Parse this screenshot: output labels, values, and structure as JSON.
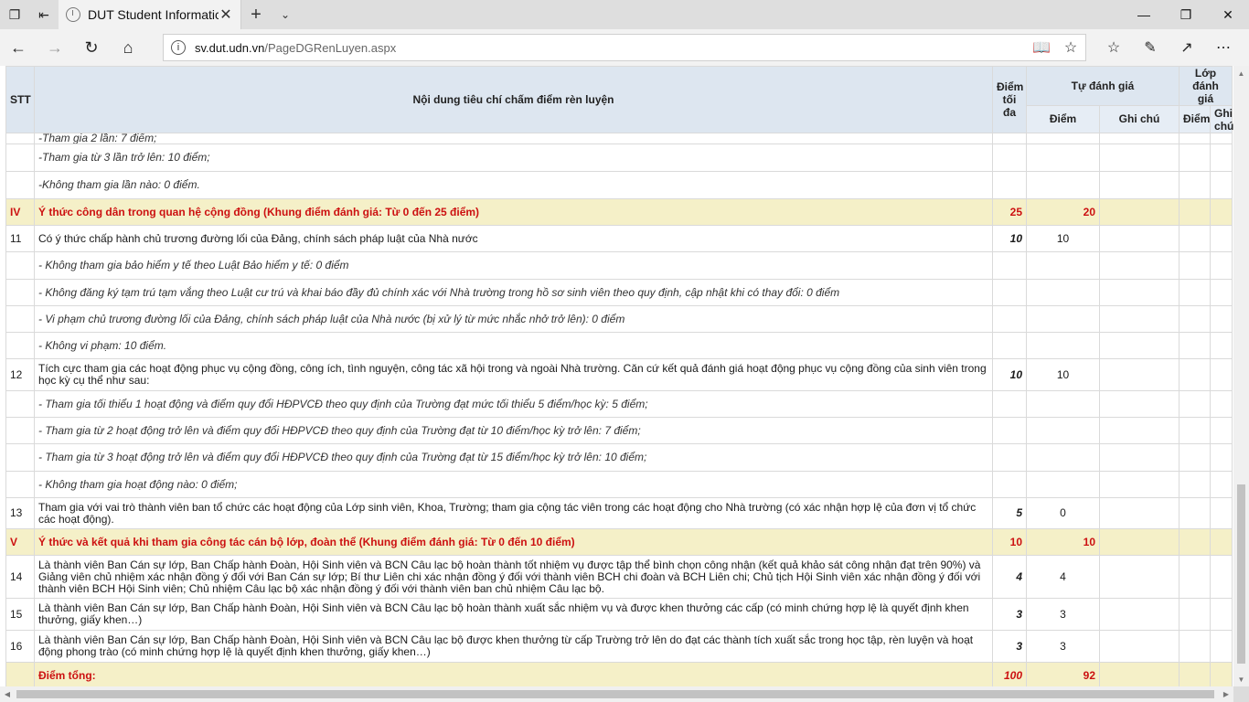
{
  "browser": {
    "tab_title": "DUT Student Informatic",
    "url_host": "sv.dut.udn.vn",
    "url_path": "/PageDGRenLuyen.aspx"
  },
  "table": {
    "headers": {
      "stt": "STT",
      "content": "Nội dung tiêu chí chấm điểm rèn luyện",
      "max_line1": "Điểm",
      "max_line2": "tối đa",
      "self": "Tự đánh giá",
      "self_score": "Điểm",
      "self_note": "Ghi chú",
      "class_line1": "Lớp",
      "class_line2": "đánh giá",
      "class_score": "Điểm",
      "class_note_line1": "Ghi",
      "class_note_line2": "chú"
    },
    "rows": [
      {
        "type": "cut",
        "text": "-Tham gia 2 lần: 7 điểm;"
      },
      {
        "type": "sub",
        "text": "-Tham gia từ 3 lần trở lên: 10 điểm;"
      },
      {
        "type": "sub",
        "text": "-Không tham gia lần nào: 0 điểm."
      },
      {
        "type": "sec",
        "stt": "IV",
        "text": "Ý thức công dân trong quan hệ cộng đồng (Khung điểm đánh giá: Từ 0 đến 25 điểm)",
        "max": "25",
        "score": "20"
      },
      {
        "type": "item",
        "stt": "11",
        "text": "Có ý thức chấp hành chủ trương đường lối của Đảng, chính sách pháp luật của Nhà nước",
        "max": "10",
        "score": "10"
      },
      {
        "type": "sub",
        "text": "- Không tham gia bảo hiểm y tế theo Luật Bảo hiểm y tế: 0 điểm"
      },
      {
        "type": "sub",
        "text": "- Không đăng ký tạm trú tạm vắng theo Luật cư trú và khai báo đầy đủ chính xác với Nhà trường trong hồ sơ sinh viên theo quy định, cập nhật khi có thay đổi: 0 điểm"
      },
      {
        "type": "sub",
        "text": "- Vi phạm chủ trương đường lối của Đảng, chính sách pháp luật của Nhà nước (bị xử lý từ mức nhắc nhở trở lên): 0 điểm"
      },
      {
        "type": "sub",
        "text": "- Không vi phạm: 10 điểm."
      },
      {
        "type": "item",
        "stt": "12",
        "text": "Tích cực tham gia các hoạt động phục vụ cộng đồng, công ích, tình nguyện, công tác xã hội trong và ngoài Nhà trường. Căn cứ kết quả đánh giá hoạt động phục vụ cộng đồng của sinh viên trong học kỳ cụ thể như sau:",
        "max": "10",
        "score": "10"
      },
      {
        "type": "sub",
        "text": "- Tham gia tối thiểu 1 hoạt động và điểm quy đổi HĐPVCĐ theo quy định của Trường đạt mức tối thiểu 5 điểm/học kỳ: 5 điểm;"
      },
      {
        "type": "sub",
        "text": "- Tham gia từ 2 hoạt động trở lên và điểm quy đổi HĐPVCĐ theo quy định của Trường đạt từ 10 điểm/học kỳ trở lên: 7 điểm;"
      },
      {
        "type": "sub",
        "text": "- Tham gia từ 3 hoạt động trở lên và điểm quy đổi HĐPVCĐ theo quy định của Trường đạt từ 15 điểm/học kỳ trở lên: 10 điểm;"
      },
      {
        "type": "sub",
        "text": "- Không tham gia hoạt động nào: 0 điểm;"
      },
      {
        "type": "item",
        "stt": "13",
        "text": "Tham gia với vai trò thành viên ban tổ chức các hoạt động của Lớp sinh viên, Khoa, Trường; tham gia cộng tác viên trong các hoạt động cho Nhà trường (có xác nhận hợp lệ của đơn vị tổ chức các hoạt động).",
        "max": "5",
        "score": "0"
      },
      {
        "type": "sec",
        "stt": "V",
        "text": "Ý thức và kết quả khi tham gia công tác cán bộ lớp, đoàn thể (Khung điểm đánh giá: Từ 0 đến 10 điểm)",
        "max": "10",
        "score": "10"
      },
      {
        "type": "item",
        "stt": "14",
        "text": "Là thành viên Ban Cán sự lớp, Ban Chấp hành Đoàn, Hội Sinh viên và BCN Câu lạc bộ hoàn thành tốt nhiệm vụ được tập thể bình chọn công nhận (kết quả khảo sát công nhận đạt trên 90%) và Giảng viên chủ nhiệm xác nhận đồng ý đối với Ban Cán sự lớp; Bí thư Liên chi xác nhận đồng ý đối với thành viên BCH chi đoàn và BCH Liên chi; Chủ tịch Hội Sinh viên xác nhận đồng ý đối với thành viên BCH Hội Sinh viên; Chủ nhiệm Câu lạc bộ xác nhận đồng ý đối với thành viên ban chủ nhiệm Câu lạc bộ.",
        "max": "4",
        "score": "4"
      },
      {
        "type": "item",
        "stt": "15",
        "text": "Là thành viên Ban Cán sự lớp, Ban Chấp hành Đoàn, Hội Sinh viên và BCN Câu lạc bộ hoàn thành xuất sắc nhiệm vụ và được khen thưởng các cấp (có minh chứng hợp lệ là quyết định khen thưởng, giấy khen…)",
        "max": "3",
        "score": "3"
      },
      {
        "type": "item",
        "stt": "16",
        "text": "Là thành viên Ban Cán sự lớp, Ban Chấp hành Đoàn, Hội Sinh viên và BCN Câu lạc bộ được khen thưởng từ cấp Trường trở lên do đạt các thành tích xuất sắc trong học tập, rèn luyện và hoạt động phong trào (có minh chứng hợp lệ là quyết định khen thưởng, giấy khen…)",
        "max": "3",
        "score": "3"
      }
    ],
    "total": {
      "label": "Điểm tổng:",
      "max": "100",
      "score": "92"
    }
  }
}
